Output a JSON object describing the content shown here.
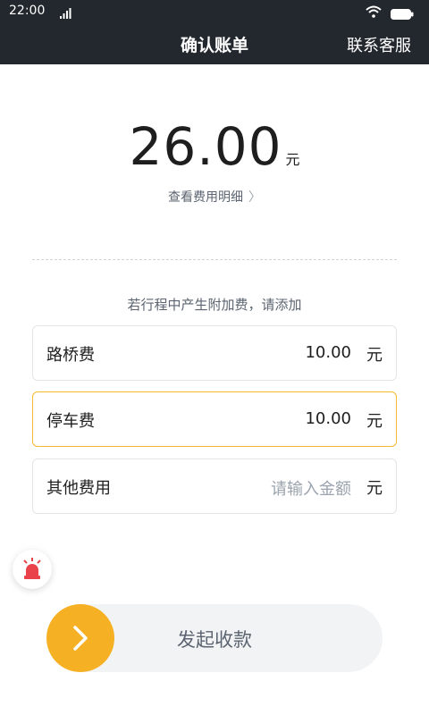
{
  "status_bar": {
    "time": "22:00",
    "icons": [
      "signal-icon",
      "wifi-icon",
      "battery-icon"
    ]
  },
  "nav": {
    "title": "确认账单",
    "service_label": "联系客服"
  },
  "bill": {
    "amount": "26.00",
    "unit": "元",
    "detail_link": "查看费用明细",
    "hint": "若行程中产生附加费，请添加"
  },
  "fees": [
    {
      "label": "路桥费",
      "value": "10.00",
      "placeholder": "",
      "unit": "元"
    },
    {
      "label": "停车费",
      "value": "10.00",
      "placeholder": "",
      "unit": "元"
    },
    {
      "label": "其他费用",
      "value": "",
      "placeholder": "请输入金额",
      "unit": "元"
    }
  ],
  "slider": {
    "label": "发起收款",
    "icon": "chevron-right-icon"
  },
  "colors": {
    "header_bg": "#23282e",
    "accent": "#f5b123",
    "active_border": "#f5b82e",
    "alarm_red": "#e9424a"
  }
}
